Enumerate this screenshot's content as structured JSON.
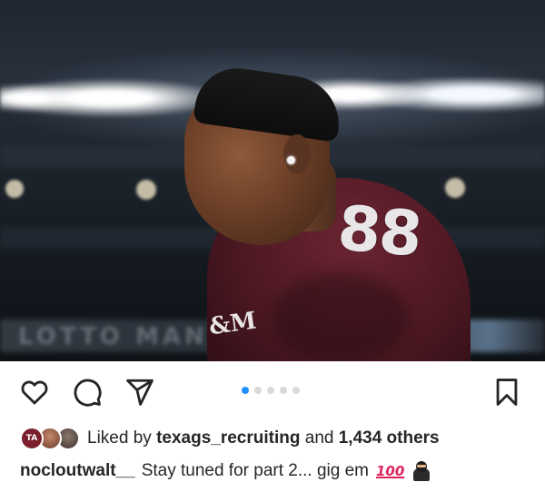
{
  "post": {
    "image": {
      "jersey_number": "88",
      "jersey_mark": "&M",
      "signage_text": "LOTTO MAN"
    },
    "carousel": {
      "total_dots": 5,
      "active_index": 0
    },
    "icons": {
      "like": "heart-icon",
      "comment": "comment-icon",
      "share": "send-icon",
      "save": "bookmark-icon"
    },
    "likes": {
      "prefix": "Liked by",
      "user": "texags_recruiting",
      "connector": "and",
      "count": "1,434 others",
      "avatar1_text": "TA"
    },
    "caption": {
      "username": "nocloutwalt__",
      "text": "Stay tuned for part 2... gig em",
      "emoji_100": "100"
    },
    "colors": {
      "active_dot": "#1e90ff",
      "inactive_dot": "#d9d9d9",
      "text": "#262626"
    }
  }
}
